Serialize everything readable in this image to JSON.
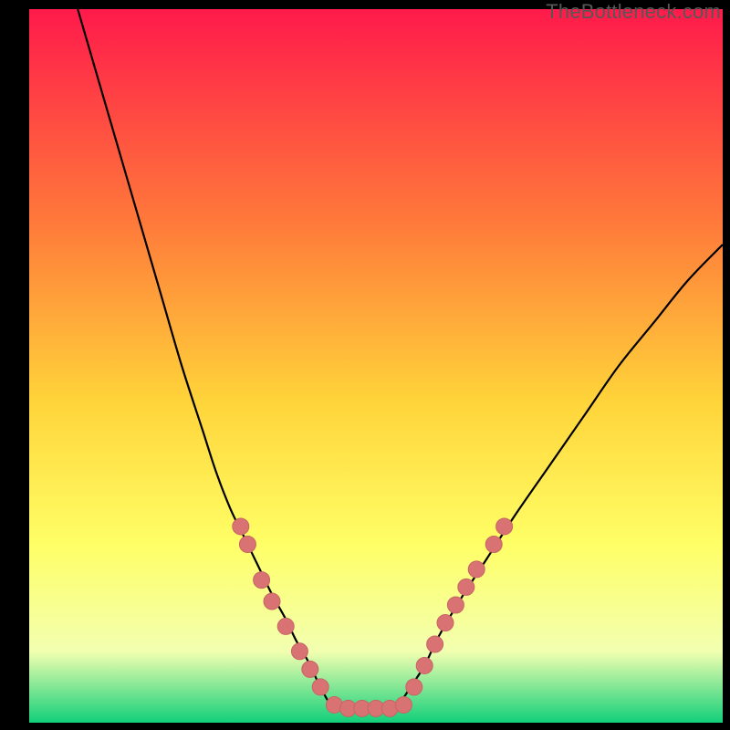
{
  "watermark": "TheBottleneck.com",
  "colors": {
    "frame": "#000000",
    "gradient_top": "#ff1a4b",
    "gradient_mid1": "#ff7a3a",
    "gradient_mid2": "#ffd43a",
    "gradient_mid3": "#ffff66",
    "gradient_mid4": "#f2ffb0",
    "gradient_bottom": "#12cf7a",
    "curve": "#000000",
    "dot_fill": "#d97373",
    "dot_stroke": "#c96464"
  },
  "chart_data": {
    "type": "line",
    "title": "",
    "xlabel": "",
    "ylabel": "",
    "xlim": [
      0,
      100
    ],
    "ylim": [
      0,
      100
    ],
    "series": [
      {
        "name": "curve-left",
        "x": [
          7,
          10,
          13,
          16,
          19,
          22,
          25,
          27,
          29,
          31,
          33,
          35,
          37,
          38.5,
          40,
          41,
          42,
          43.5,
          45
        ],
        "y": [
          100,
          90,
          80,
          70,
          60,
          50,
          41,
          35,
          30,
          26,
          22,
          18,
          14.5,
          11.5,
          9,
          7,
          5,
          2.5,
          2
        ]
      },
      {
        "name": "curve-flat",
        "x": [
          45,
          47,
          49,
          51,
          53
        ],
        "y": [
          2,
          2,
          2,
          2,
          2
        ]
      },
      {
        "name": "curve-right",
        "x": [
          53,
          55,
          57,
          59,
          62,
          66,
          70,
          75,
          80,
          85,
          90,
          95,
          100
        ],
        "y": [
          2,
          5,
          8,
          12,
          17,
          23,
          29,
          36,
          43,
          50,
          56,
          62,
          67
        ]
      }
    ],
    "dots": {
      "name": "markers",
      "points": [
        {
          "x": 30.5,
          "y": 27.5
        },
        {
          "x": 31.5,
          "y": 25
        },
        {
          "x": 33.5,
          "y": 20
        },
        {
          "x": 35,
          "y": 17
        },
        {
          "x": 37,
          "y": 13.5
        },
        {
          "x": 39,
          "y": 10
        },
        {
          "x": 40.5,
          "y": 7.5
        },
        {
          "x": 42,
          "y": 5
        },
        {
          "x": 44,
          "y": 2.5
        },
        {
          "x": 46,
          "y": 2
        },
        {
          "x": 48,
          "y": 2
        },
        {
          "x": 50,
          "y": 2
        },
        {
          "x": 52,
          "y": 2
        },
        {
          "x": 54,
          "y": 2.5
        },
        {
          "x": 55.5,
          "y": 5
        },
        {
          "x": 57,
          "y": 8
        },
        {
          "x": 58.5,
          "y": 11
        },
        {
          "x": 60,
          "y": 14
        },
        {
          "x": 61.5,
          "y": 16.5
        },
        {
          "x": 63,
          "y": 19
        },
        {
          "x": 64.5,
          "y": 21.5
        },
        {
          "x": 67,
          "y": 25
        },
        {
          "x": 68.5,
          "y": 27.5
        }
      ]
    }
  }
}
